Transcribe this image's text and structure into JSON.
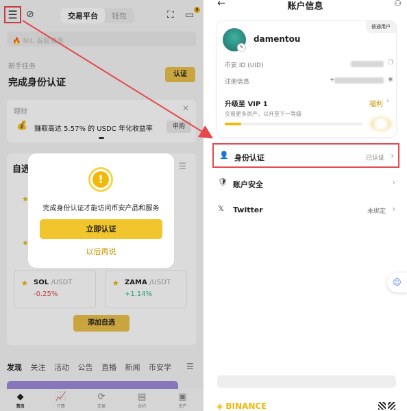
{
  "left": {
    "segment": [
      "交易平台",
      "钱包"
    ],
    "chat_badge": "8",
    "search_placeholder": "NIL 当前领涨",
    "task_label": "新手任务",
    "task_title": "完成身份认证",
    "verify_button": "认证",
    "wealth": {
      "label": "理财",
      "text": "赚取高达 5.57% 的 USDC 年化收益率",
      "apply": "申购"
    },
    "favorites": {
      "title": "自选",
      "coins": [
        {
          "name": "SOL",
          "quote": "/USDT",
          "change": "-0.25%",
          "change_color": "#e5484d"
        },
        {
          "name": "ZAMA",
          "quote": "/USDT",
          "change": "+1.14%",
          "change_color": "#2ebd85"
        }
      ],
      "add_button": "添加自选"
    },
    "news_tabs": [
      "发现",
      "关注",
      "活动",
      "公告",
      "直播",
      "新闻",
      "币安学"
    ],
    "bottom_nav": [
      {
        "label": "首页",
        "icon": "◆"
      },
      {
        "label": "行情",
        "icon": "📈"
      },
      {
        "label": "交易",
        "icon": "⟳"
      },
      {
        "label": "合约",
        "icon": "▤"
      },
      {
        "label": "资产",
        "icon": "▣"
      }
    ],
    "modal": {
      "message": "完成身份认证才能访问币安产品和服务",
      "primary": "立即认证",
      "secondary": "以后再说"
    }
  },
  "right": {
    "title": "账户信息",
    "user_badge": "普通用户",
    "username": "damentou",
    "uid_label": "币安 ID (UID)",
    "reg_label": "注册信息",
    "reg_prefix": "+",
    "vip": {
      "title": "升级至 VIP 1",
      "desc": "交易更多资产，以升至下一等级",
      "benefit": "福利",
      "progress": 0.12
    },
    "menu": [
      {
        "icon": "👤",
        "label": "身份认证",
        "value": "已认证"
      },
      {
        "icon": "🛡",
        "label": "账户安全",
        "value": ""
      },
      {
        "icon": "𝕏",
        "label": "Twitter",
        "value": "未绑定"
      }
    ],
    "footer_brand": "◈ BINANCE"
  },
  "colors": {
    "accent": "#f0b90b",
    "highlight": "#e5484d",
    "down": "#e5484d",
    "up": "#2ebd85"
  }
}
